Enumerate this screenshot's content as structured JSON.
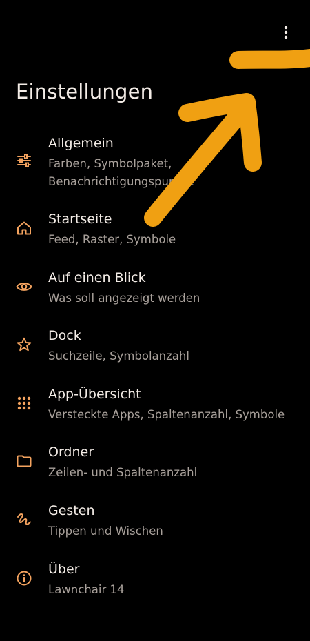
{
  "header": {
    "title": "Einstellungen",
    "menu_icon": "more-vert-icon"
  },
  "colors": {
    "background": "#000000",
    "accent": "#f4a35f",
    "text_primary": "#f3ece6",
    "text_secondary": "#a9a19b",
    "annotation_arrow": "#f0a012"
  },
  "items": [
    {
      "label": "Allgemein",
      "sub_line1": "Farben, Symbolpaket,",
      "sub_line2": "Benachrichtigungspunkte",
      "icon": "tune-sliders-icon"
    },
    {
      "label": "Startseite",
      "sub": "Feed, Raster, Symbole",
      "icon": "home-icon"
    },
    {
      "label": "Auf einen Blick",
      "sub": "Was soll angezeigt werden",
      "icon": "eye-icon"
    },
    {
      "label": "Dock",
      "sub": "Suchzeile, Symbolanzahl",
      "icon": "star-icon"
    },
    {
      "label": "App-Übersicht",
      "sub": "Versteckte Apps, Spaltenanzahl, Symbole",
      "icon": "app-grid-icon"
    },
    {
      "label": "Ordner",
      "sub": "Zeilen- und Spaltenanzahl",
      "icon": "folder-icon"
    },
    {
      "label": "Gesten",
      "sub": "Tippen und Wischen",
      "icon": "gesture-icon"
    },
    {
      "label": "Über",
      "sub": "Lawnchair 14",
      "icon": "info-icon"
    }
  ]
}
